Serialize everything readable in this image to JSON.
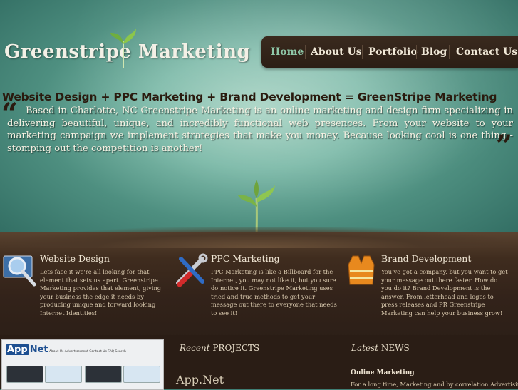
{
  "brand": {
    "logo_text": "Greenstripe Marketing"
  },
  "nav": {
    "items": [
      {
        "label": "Home",
        "active": true
      },
      {
        "label": "About Us",
        "active": false
      },
      {
        "label": "Portfolio",
        "active": false
      },
      {
        "label": "Blog",
        "active": false
      },
      {
        "label": "Contact Us",
        "active": false
      }
    ]
  },
  "hero": {
    "tagline": "Website Design  +  PPC Marketing  +  Brand Development   =  GreenStripe Marketing",
    "intro": "Based in Charlotte, NC Greenstripe Marketing is an online marketing and design firm specializing in delivering beautiful, unique, and incredibly functional web presences. From your website to your marketing campaign we implement strategies that make you money. Because looking cool is one thing - stomping out the competition is another!"
  },
  "features": [
    {
      "title": "Website Design",
      "icon": "magnifying-glass-icon",
      "text": "Lets face it we're all looking for that element that sets us apart. Greenstripe Marketing provides that element, giving your business the edge it needs by producing unique and forward looking Internet Identities!"
    },
    {
      "title": "PPC Marketing",
      "icon": "tools-icon",
      "text": "PPC Marketing is like a Billboard for the Internet, you may not like it, but you sure do notice it. Greenstripe Marketing uses tried and true methods to get your message out there to everyone that needs to see it!"
    },
    {
      "title": "Brand Development",
      "icon": "safety-vest-icon",
      "text": "You've got a company, but you want to get your message out there faster. How do you do it? Brand Development is the answer. From letterhead and logos to press releases and PR Greenstripe Marketing can help your business grow!"
    }
  ],
  "projects": {
    "heading_italic": "Recent",
    "heading_rest": "PROJECTS",
    "title": "App.Net",
    "thumb": {
      "logo_badge": "App",
      "logo_rest": "Net",
      "nav_text": "About Us   Advertisement   Contact Us   FAQ   Search"
    }
  },
  "news": {
    "heading_italic": "Latest",
    "heading_rest": "NEWS",
    "item_title": "Online Marketing",
    "item_text": "For a long time, Marketing and by correlation Advertising were"
  },
  "colors": {
    "nav_active": "#8fc9a9",
    "soil": "#33231a",
    "sky": "#7fbbaa"
  }
}
